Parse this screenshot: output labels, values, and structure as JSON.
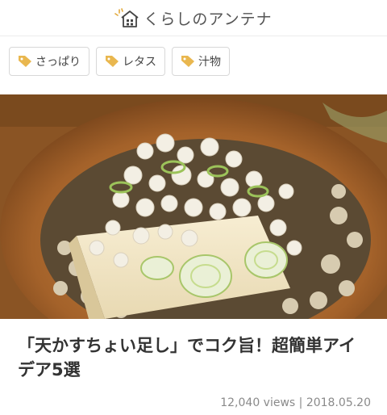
{
  "header": {
    "logo_text": "くらしのアンテナ"
  },
  "tags": [
    {
      "label": "さっぱり"
    },
    {
      "label": "レタス"
    },
    {
      "label": "汁物"
    }
  ],
  "article": {
    "title": "「天かすちょい足し」でコク旨！超簡単アイデア5選",
    "views": "12,040 views",
    "separator": "|",
    "date": "2018.05.20"
  },
  "colors": {
    "accent": "#e2a93b",
    "text": "#333333",
    "muted": "#8a8a8a"
  }
}
